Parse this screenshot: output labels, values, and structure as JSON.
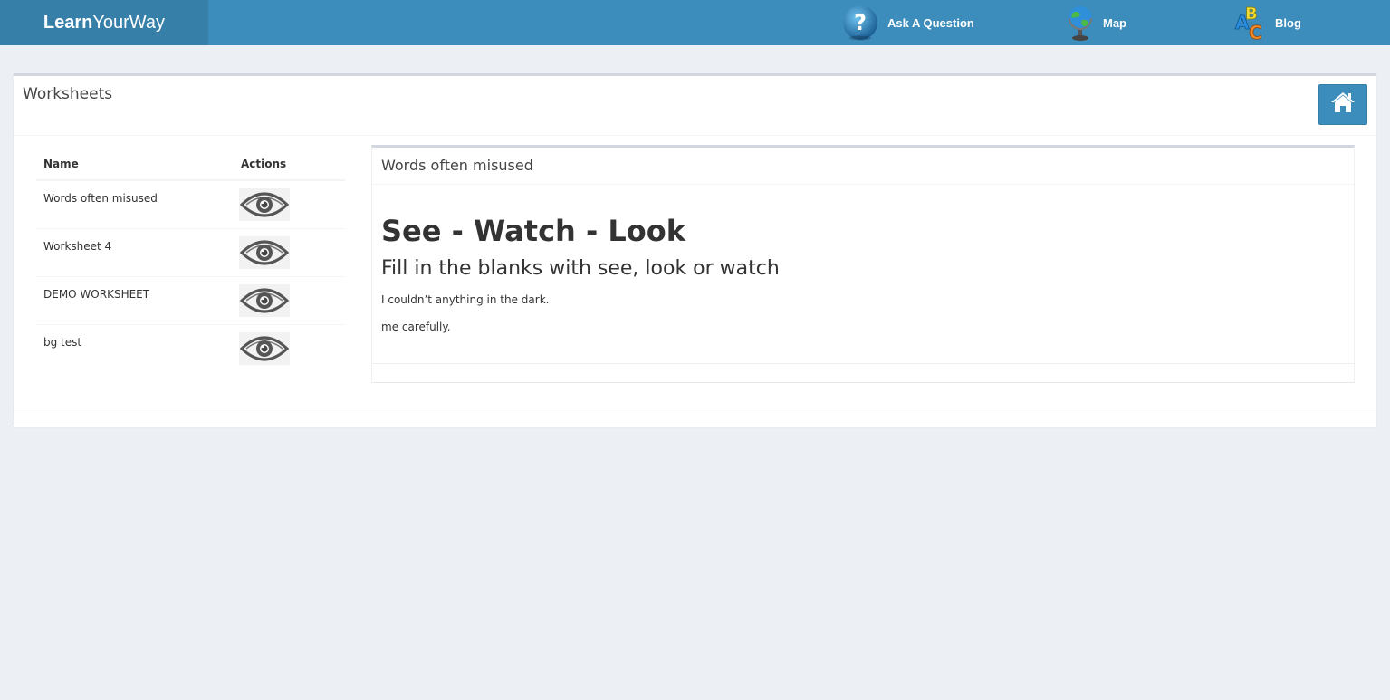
{
  "header": {
    "logo_bold": "Learn",
    "logo_rest": "YourWay",
    "nav": [
      {
        "label": "Ask A Question",
        "icon": "question-icon"
      },
      {
        "label": "Map",
        "icon": "globe-icon"
      },
      {
        "label": "Blog",
        "icon": "abc-blocks-icon"
      }
    ],
    "colors": {
      "bar": "#3c8dbc",
      "logo_bg": "#367fa9"
    }
  },
  "box": {
    "title": "Worksheets",
    "home_icon": "home-icon"
  },
  "table": {
    "columns": [
      "Name",
      "Actions"
    ],
    "rows": [
      {
        "name": "Words often misused",
        "action_icon": "eye-icon"
      },
      {
        "name": "Worksheet 4",
        "action_icon": "eye-icon"
      },
      {
        "name": "DEMO WORKSHEET",
        "action_icon": "eye-icon"
      },
      {
        "name": "bg test",
        "action_icon": "eye-icon"
      }
    ]
  },
  "preview": {
    "title": "Words often misused",
    "heading": "See - Watch - Look",
    "subheading": "Fill in the blanks with see, look or watch",
    "lines": [
      "I couldn’t anything in the dark.",
      "me carefully."
    ]
  }
}
